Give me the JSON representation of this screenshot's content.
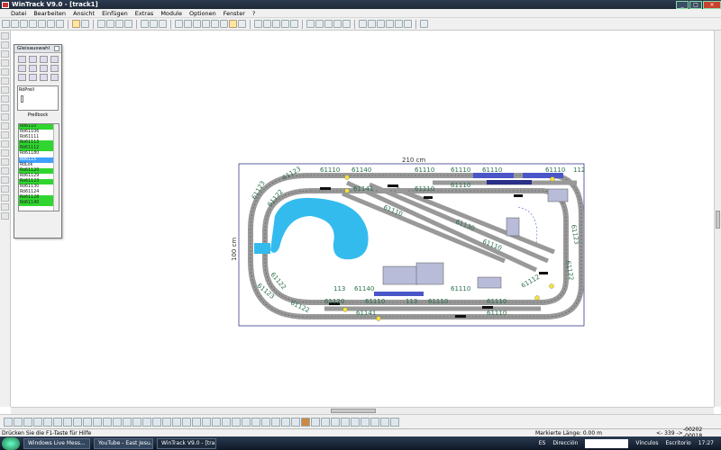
{
  "window": {
    "title": "WinTrack  V9.0 - [track1]"
  },
  "menu": [
    "Datei",
    "Bearbeiten",
    "Ansicht",
    "Einfügen",
    "Extras",
    "Module",
    "Optionen",
    "Fenster",
    "?"
  ],
  "palette": {
    "title": "Gleisauswahl",
    "preview_label": "RöPrell",
    "preview_caption": "Prellbock",
    "items": [
      {
        "label": "Rö6110",
        "hl": "g"
      },
      {
        "label": "Rö61106",
        "hl": ""
      },
      {
        "label": "Rö61111",
        "hl": ""
      },
      {
        "label": "Rö61113",
        "hl": "g"
      },
      {
        "label": "Rö61112",
        "hl": "g"
      },
      {
        "label": "Rö61180",
        "hl": ""
      },
      {
        "label": "Rö6115",
        "hl": "b"
      },
      {
        "label": "RöLok",
        "hl": ""
      },
      {
        "label": "Rö61120",
        "hl": "g"
      },
      {
        "label": "Rö61129",
        "hl": ""
      },
      {
        "label": "Rö61123",
        "hl": "g"
      },
      {
        "label": "Rö61130",
        "hl": ""
      },
      {
        "label": "Rö61124",
        "hl": ""
      },
      {
        "label": "Rö61128",
        "hl": "g"
      },
      {
        "label": "Rö61140",
        "hl": "g"
      }
    ]
  },
  "layout": {
    "width_dim": "210 cm",
    "height_dim": "100 cm",
    "labels": {
      "t_61110": "61110",
      "t_61122": "61122",
      "t_61123": "61123",
      "t_61140": "61140",
      "t_61141": "61141",
      "t_61130": "61130",
      "t_61112": "61112",
      "t_113": "113",
      "t_112": "112",
      "t_61120": "61120"
    }
  },
  "status": {
    "hint": "Drücken Sie die  F1-Taste für Hilfe",
    "length": "Markierte Länge:  0.00 m",
    "coord_x": "<- 339 ->",
    "coord_y": "-00202   -00018"
  },
  "taskbar": {
    "buttons": [
      "Windows Live Mess...",
      "YouTube - East Jesu...",
      "WinTrack  V9.0 - [tra..."
    ],
    "lang": "ES",
    "address_label": "Dirección",
    "links_label": "Vínculos",
    "desktop_label": "Escritorio",
    "clock": "17:27"
  }
}
